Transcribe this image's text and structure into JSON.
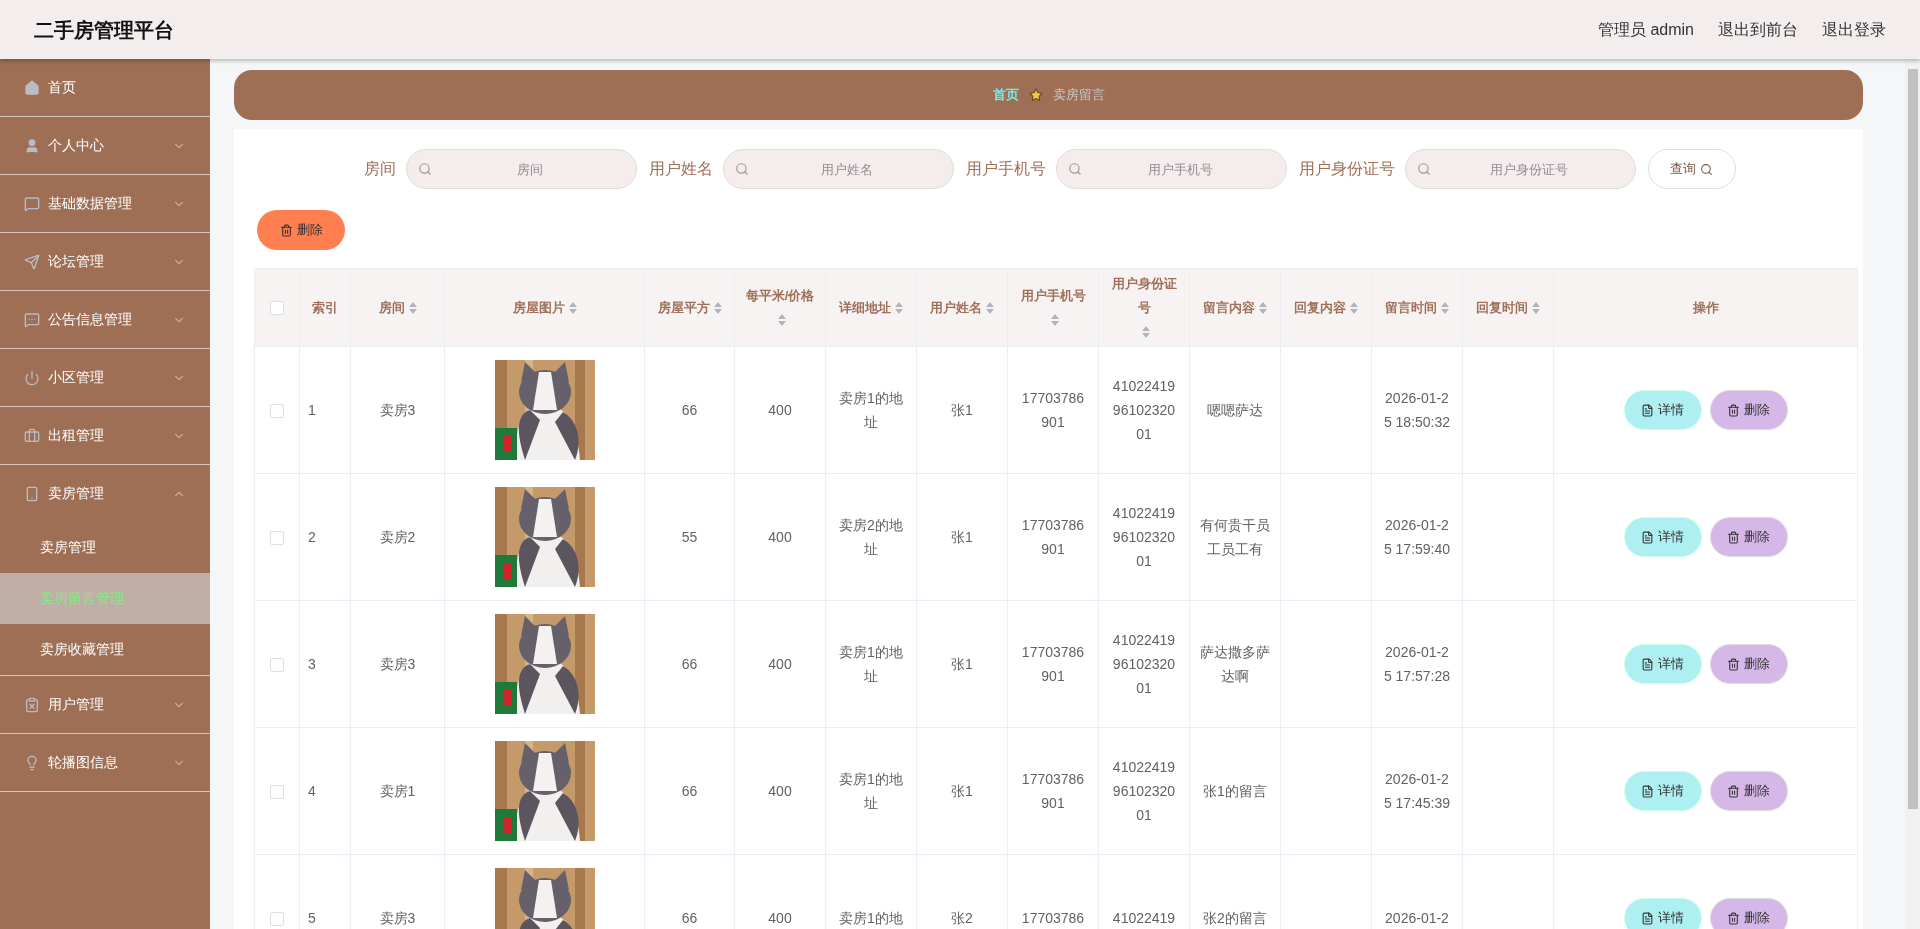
{
  "header": {
    "title": "二手房管理平台",
    "links": [
      "管理员 admin",
      "退出到前台",
      "退出登录"
    ]
  },
  "sidebar": {
    "items": [
      {
        "label": "首页"
      },
      {
        "label": "个人中心",
        "expanded": false
      },
      {
        "label": "基础数据管理",
        "expanded": false
      },
      {
        "label": "论坛管理",
        "expanded": false
      },
      {
        "label": "公告信息管理",
        "expanded": false
      },
      {
        "label": "小区管理",
        "expanded": false
      },
      {
        "label": "出租管理",
        "expanded": false
      },
      {
        "label": "卖房管理",
        "expanded": true,
        "children": [
          {
            "label": "卖房管理",
            "selected": false
          },
          {
            "label": "卖房留言管理",
            "selected": true
          },
          {
            "label": "卖房收藏管理",
            "selected": false
          }
        ]
      },
      {
        "label": "用户管理",
        "expanded": false
      },
      {
        "label": "轮播图信息",
        "expanded": false
      }
    ]
  },
  "breadcrumb": [
    {
      "label": "首页",
      "current": false
    },
    {
      "label": "卖房留言",
      "current": true
    }
  ],
  "filters": [
    {
      "label": "房间",
      "placeholder": "房间"
    },
    {
      "label": "用户姓名",
      "placeholder": "用户姓名"
    },
    {
      "label": "用户手机号",
      "placeholder": "用户手机号"
    },
    {
      "label": "用户身份证号",
      "placeholder": "用户身份证号"
    }
  ],
  "search_button": "查询",
  "delete_button": "删除",
  "table": {
    "select_all_checked": false,
    "columns": [
      {
        "label": "索引",
        "sortable": false
      },
      {
        "label": "房间",
        "sortable": true
      },
      {
        "label": "房屋图片",
        "sortable": true
      },
      {
        "label": "房屋平方",
        "sortable": true
      },
      {
        "label": "每平米/价格",
        "sortable": true
      },
      {
        "label": "详细地址",
        "sortable": true
      },
      {
        "label": "用户姓名",
        "sortable": true
      },
      {
        "label": "用户手机号",
        "sortable": true
      },
      {
        "label": "用户身份证号",
        "sortable": true
      },
      {
        "label": "留言内容",
        "sortable": true
      },
      {
        "label": "回复内容",
        "sortable": true
      },
      {
        "label": "留言时间",
        "sortable": true
      },
      {
        "label": "回复时间",
        "sortable": true
      },
      {
        "label": "操作",
        "sortable": false
      }
    ],
    "rows": [
      {
        "checked": false,
        "cells": [
          "1",
          "卖房3",
          {
            "kind": "picture"
          },
          "66",
          "400",
          "卖房1的地址",
          "张1",
          "17703786901",
          "410224199610232001",
          "嗯嗯萨达",
          "",
          "2026-01-25 18:50:32",
          ""
        ],
        "actions": [
          "详情",
          "删除"
        ]
      },
      {
        "checked": false,
        "cells": [
          "2",
          "卖房2",
          {
            "kind": "picture"
          },
          "55",
          "400",
          "卖房2的地址",
          "张1",
          "17703786901",
          "410224199610232001",
          "有何贵干员工员工有",
          "",
          "2026-01-25 17:59:40",
          ""
        ],
        "actions": [
          "详情",
          "删除"
        ]
      },
      {
        "checked": false,
        "cells": [
          "3",
          "卖房3",
          {
            "kind": "picture"
          },
          "66",
          "400",
          "卖房1的地址",
          "张1",
          "17703786901",
          "410224199610232001",
          "萨达撒多萨达啊",
          "",
          "2026-01-25 17:57:28",
          ""
        ],
        "actions": [
          "详情",
          "删除"
        ]
      },
      {
        "checked": false,
        "cells": [
          "4",
          "卖房1",
          {
            "kind": "picture"
          },
          "66",
          "400",
          "卖房1的地址",
          "张1",
          "17703786901",
          "410224199610232001",
          "张1的留言",
          "",
          "2026-01-25 17:45:39",
          ""
        ],
        "actions": [
          "详情",
          "删除"
        ]
      },
      {
        "checked": false,
        "cells": [
          "5",
          "卖房3",
          {
            "kind": "picture"
          },
          "66",
          "400",
          "卖房1的地",
          "张2",
          "17703786",
          "41022419",
          "张2的留言",
          "",
          "2026-01-2",
          ""
        ],
        "actions": [
          "详情",
          "删除"
        ]
      }
    ]
  }
}
